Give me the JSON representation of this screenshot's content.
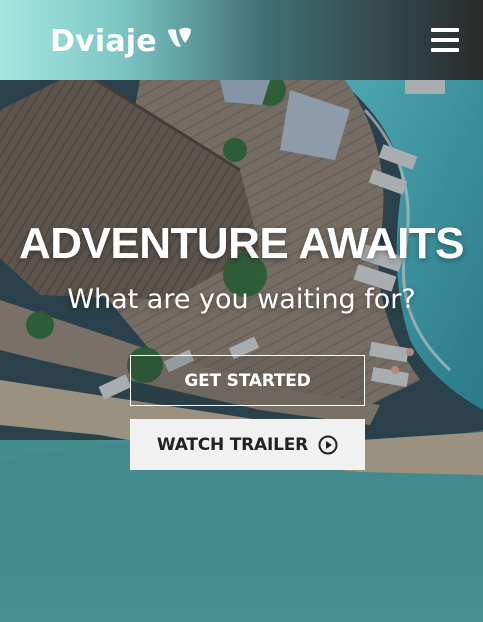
{
  "header": {
    "brand": "Dviaje",
    "logo_icon": "typo3-logo-icon",
    "menu_icon": "hamburger-menu-icon"
  },
  "hero": {
    "title": "ADVENTURE AWAITS",
    "subtitle": "What are you waiting for?",
    "primary_button": "GET STARTED",
    "secondary_button": "WATCH TRAILER",
    "secondary_icon": "play-circle-icon"
  },
  "colors": {
    "header_gradient_start": "#a6e6e0",
    "header_gradient_end": "#2a2a2a",
    "text": "#ffffff",
    "secondary_button_bg": "#f1f1f1",
    "secondary_button_text": "#222222"
  }
}
